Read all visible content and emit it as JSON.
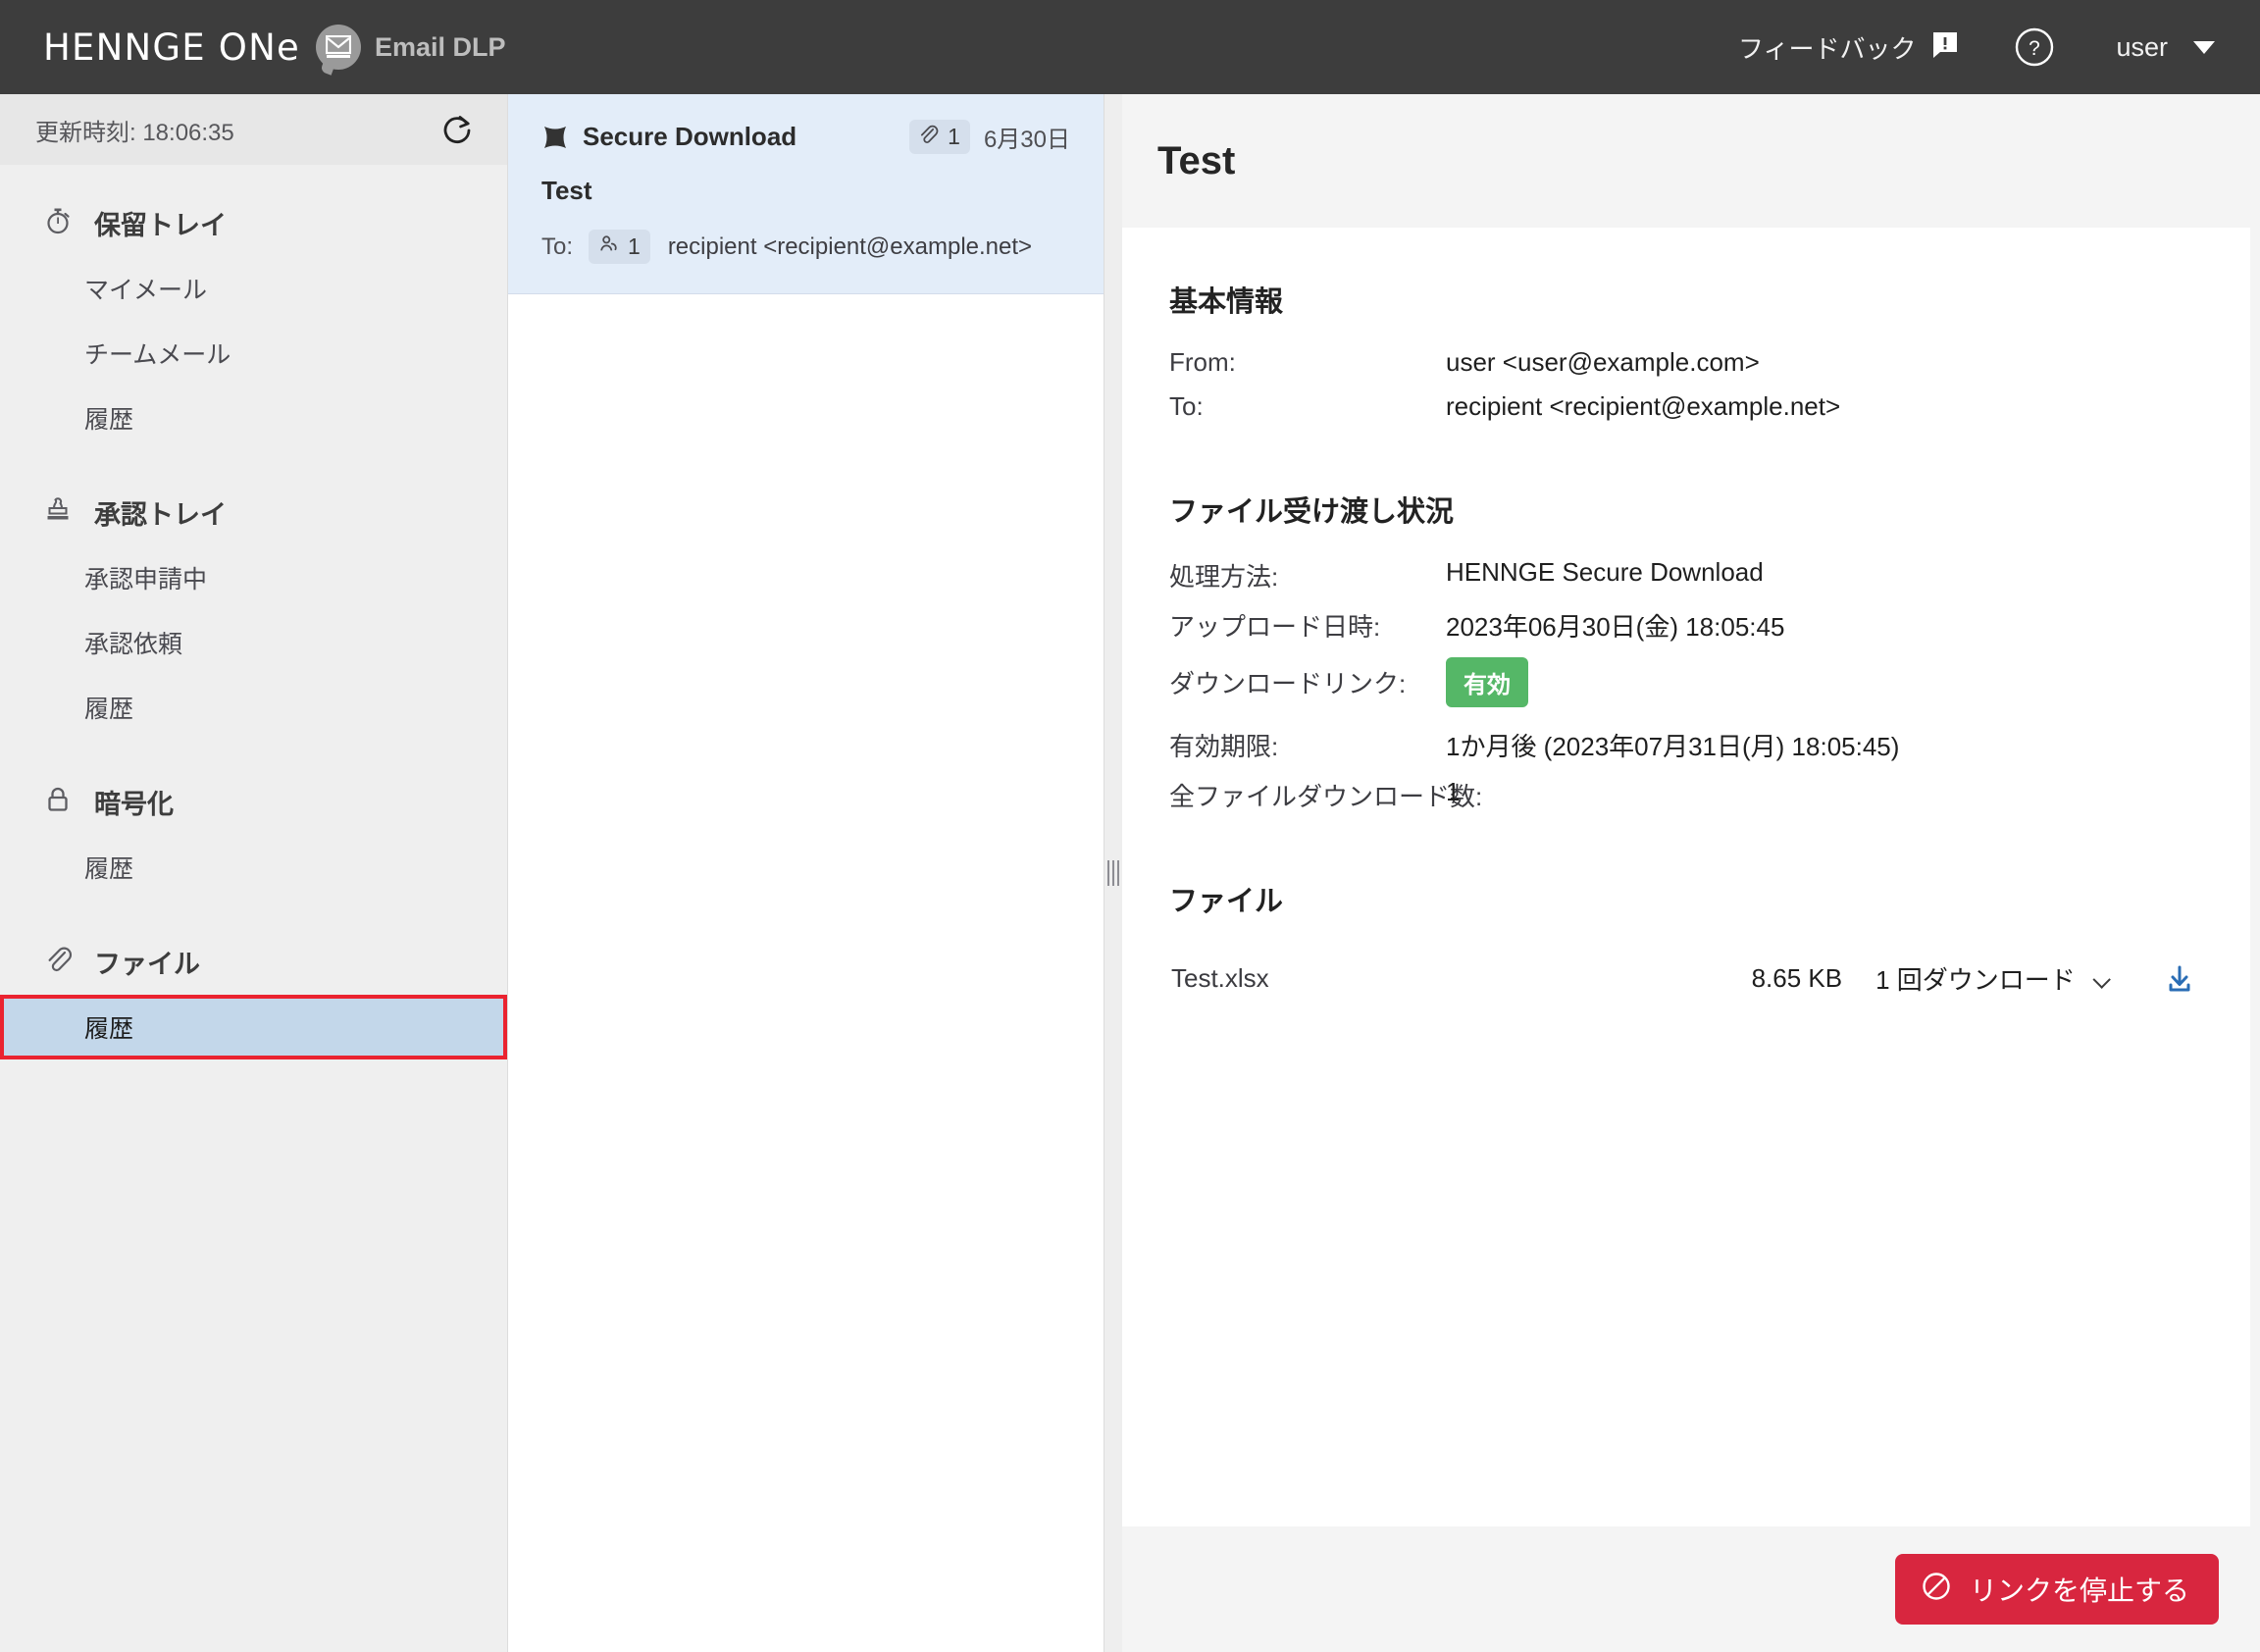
{
  "header": {
    "brand_logo": "HENNGE ONe",
    "brand_sub": "Email DLP",
    "mail_icon": "mail-icon",
    "feedback_label": "フィードバック",
    "feedback_icon": "feedback-comment-icon",
    "help_icon": "help-circle-icon",
    "user_name": "user",
    "caret_icon": "caret-down-icon",
    "bg_color": "#3d3d3d"
  },
  "sidebar": {
    "refresh_time": "更新時刻: 18:06:35",
    "refresh_icon": "refresh-icon",
    "groups": [
      {
        "icon": "stopwatch-icon",
        "title": "保留トレイ",
        "items": [
          {
            "label": "マイメール",
            "selected": false
          },
          {
            "label": "チームメール",
            "selected": false
          },
          {
            "label": "履歴",
            "selected": false
          }
        ]
      },
      {
        "icon": "stamp-icon",
        "title": "承認トレイ",
        "items": [
          {
            "label": "承認申請中",
            "selected": false
          },
          {
            "label": "承認依頼",
            "selected": false
          },
          {
            "label": "履歴",
            "selected": false
          }
        ]
      },
      {
        "icon": "lock-icon",
        "title": "暗号化",
        "items": [
          {
            "label": "履歴",
            "selected": false
          }
        ]
      },
      {
        "icon": "paperclip-icon",
        "title": "ファイル",
        "items": [
          {
            "label": "履歴",
            "selected": true
          }
        ]
      }
    ],
    "selection_highlight_color": "#ea2330",
    "selection_bg_color": "#c3d7ea"
  },
  "mail_list": {
    "items": [
      {
        "type_icon": "secure-download-icon",
        "type_label": "Secure Download",
        "attachment_icon": "paperclip-icon",
        "attachment_count": "1",
        "date": "6月30日",
        "subject": "Test",
        "to_label": "To:",
        "recipient_icon": "people-icon",
        "recipient_count": "1",
        "recipient": "recipient <recipient@example.net>",
        "selected": true
      }
    ]
  },
  "detail": {
    "title": "Test",
    "section_basic": {
      "heading": "基本情報",
      "rows": [
        {
          "key": "From:",
          "value": "user <user@example.com>"
        },
        {
          "key": "To:",
          "value": "recipient <recipient@example.net>"
        }
      ]
    },
    "section_transfer": {
      "heading": "ファイル受け渡し状況",
      "rows": [
        {
          "key": "処理方法:",
          "value": "HENNGE Secure Download"
        },
        {
          "key": "アップロード日時:",
          "value": "2023年06月30日(金) 18:05:45"
        }
      ],
      "link_row": {
        "key": "ダウンロードリンク:",
        "badge": "有効",
        "badge_color": "#55b767"
      },
      "rows_after": [
        {
          "key": "有効期限:",
          "value": "1か月後 (2023年07月31日(月) 18:05:45)"
        },
        {
          "key": "全ファイルダウンロード数:",
          "value": "1"
        }
      ]
    },
    "section_files": {
      "heading": "ファイル",
      "files": [
        {
          "name": "Test.xlsx",
          "size": "8.65 KB",
          "download_count": "1 回ダウンロード",
          "expand_icon": "chevron-down-icon",
          "download_icon": "download-icon",
          "download_icon_color": "#2a6db5"
        }
      ]
    },
    "footer": {
      "stop_button_label": "リンクを停止する",
      "stop_button_icon": "no-entry-icon",
      "stop_button_color": "#d8263f"
    }
  },
  "splitter": {
    "handle_icon": "drag-handle-icon"
  }
}
